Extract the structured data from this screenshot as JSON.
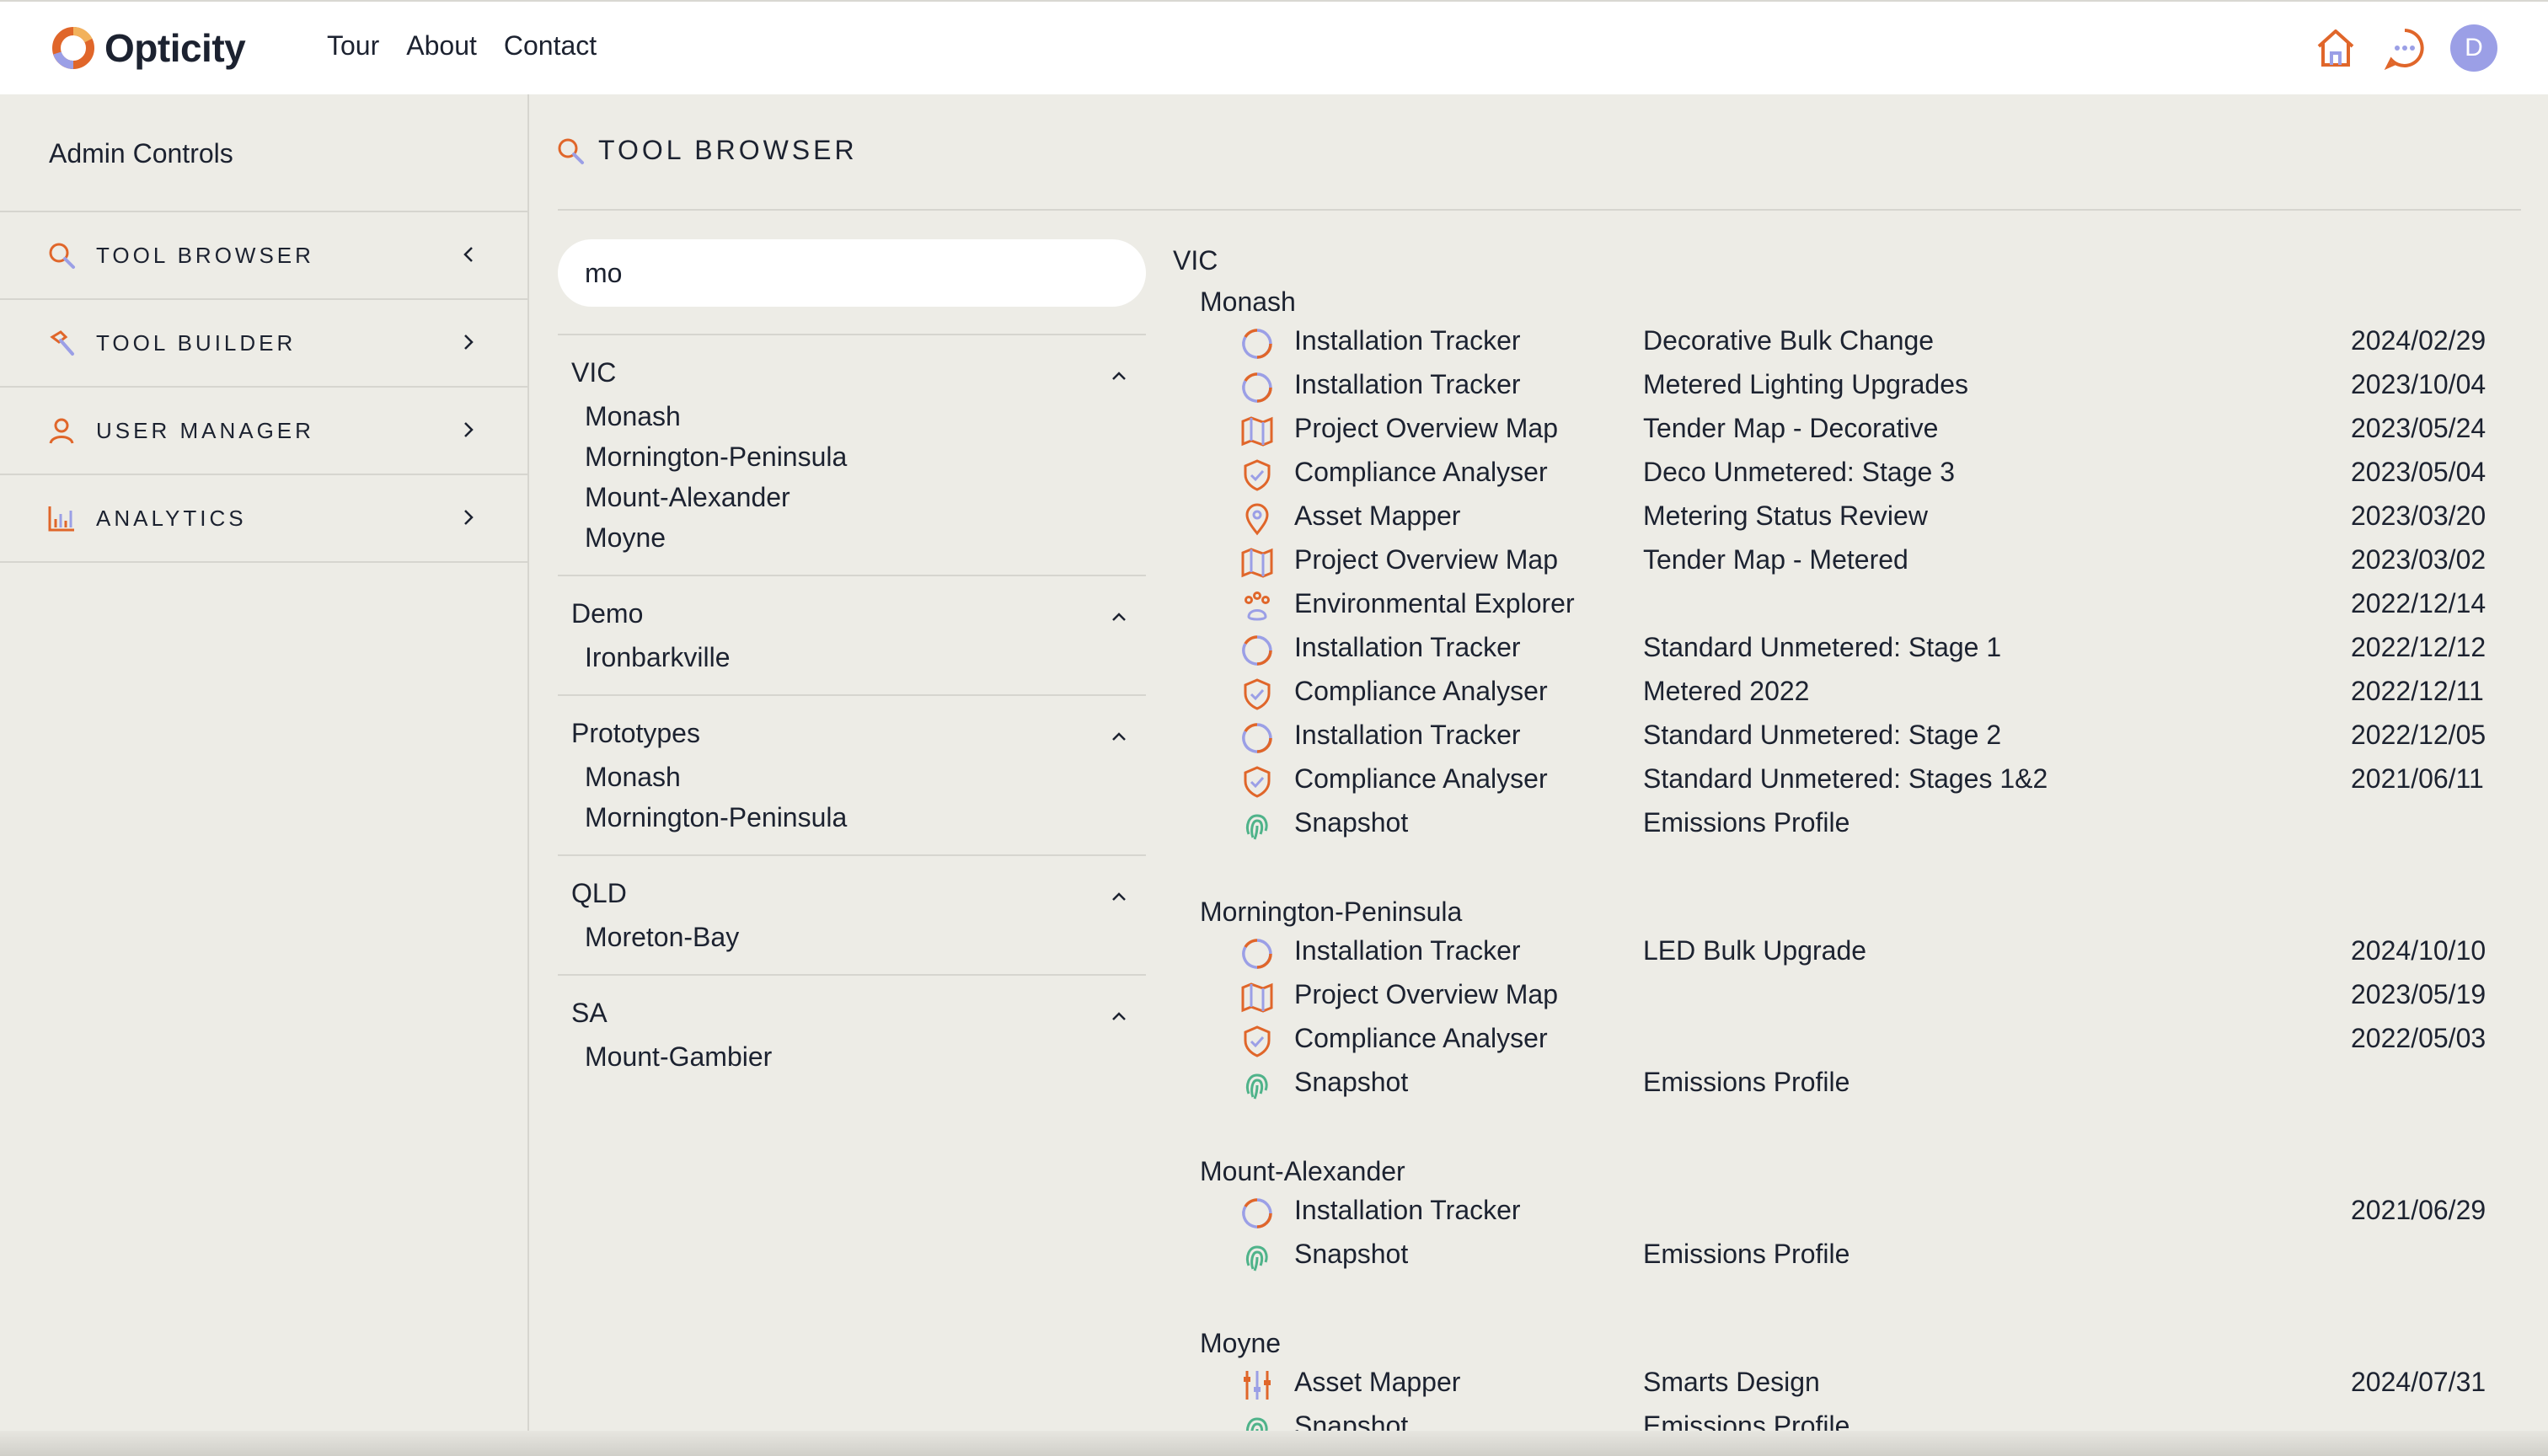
{
  "brand": {
    "name": "Opticity"
  },
  "nav": [
    {
      "label": "Tour"
    },
    {
      "label": "About"
    },
    {
      "label": "Contact"
    }
  ],
  "top_icons": [
    "home-icon",
    "chat-icon"
  ],
  "user": {
    "initial": "D"
  },
  "colors": {
    "accent_orange": "#e0662a",
    "accent_lavender": "#9b9fe6",
    "accent_green": "#4fb38a",
    "background": "#edece6"
  },
  "sidebar": {
    "title": "Admin Controls",
    "items": [
      {
        "label": "TOOL BROWSER",
        "icon": "search-icon",
        "chevron": "left"
      },
      {
        "label": "TOOL BUILDER",
        "icon": "hammer-icon",
        "chevron": "right"
      },
      {
        "label": "USER MANAGER",
        "icon": "user-icon",
        "chevron": "right"
      },
      {
        "label": "ANALYTICS",
        "icon": "bar-chart-icon",
        "chevron": "right"
      }
    ]
  },
  "main": {
    "title": "TOOL BROWSER"
  },
  "search": {
    "value": "mo"
  },
  "filters": [
    {
      "name": "VIC",
      "items": [
        "Monash",
        "Mornington-Peninsula",
        "Mount-Alexander",
        "Moyne"
      ]
    },
    {
      "name": "Demo",
      "items": [
        "Ironbarkville"
      ]
    },
    {
      "name": "Prototypes",
      "items": [
        "Monash",
        "Mornington-Peninsula"
      ]
    },
    {
      "name": "QLD",
      "items": [
        "Moreton-Bay"
      ]
    },
    {
      "name": "SA",
      "items": [
        "Mount-Gambier"
      ]
    }
  ],
  "results": {
    "state": "VIC",
    "groups": [
      {
        "name": "Monash",
        "rows": [
          {
            "icon": "progress-ring-icon",
            "tool": "Installation Tracker",
            "project": "Decorative Bulk Change",
            "date": "2024/02/29"
          },
          {
            "icon": "progress-ring-icon",
            "tool": "Installation Tracker",
            "project": "Metered Lighting Upgrades",
            "date": "2023/10/04"
          },
          {
            "icon": "map-icon",
            "tool": "Project Overview Map",
            "project": "Tender Map - Decorative",
            "date": "2023/05/24"
          },
          {
            "icon": "shield-check-icon",
            "tool": "Compliance Analyser",
            "project": "Deco Unmetered: Stage 3",
            "date": "2023/05/04"
          },
          {
            "icon": "map-pin-icon",
            "tool": "Asset Mapper",
            "project": "Metering Status Review",
            "date": "2023/03/20"
          },
          {
            "icon": "map-icon",
            "tool": "Project Overview Map",
            "project": "Tender Map - Metered",
            "date": "2023/03/02"
          },
          {
            "icon": "paw-icon",
            "tool": "Environmental Explorer",
            "project": "",
            "date": "2022/12/14"
          },
          {
            "icon": "progress-ring-icon",
            "tool": "Installation Tracker",
            "project": "Standard Unmetered: Stage 1",
            "date": "2022/12/12"
          },
          {
            "icon": "shield-check-icon",
            "tool": "Compliance Analyser",
            "project": "Metered 2022",
            "date": "2022/12/11"
          },
          {
            "icon": "progress-ring-icon",
            "tool": "Installation Tracker",
            "project": "Standard Unmetered: Stage 2",
            "date": "2022/12/05"
          },
          {
            "icon": "shield-check-icon",
            "tool": "Compliance Analyser",
            "project": "Standard Unmetered: Stages 1&2",
            "date": "2021/06/11"
          },
          {
            "icon": "fingerprint-icon",
            "tool": "Snapshot",
            "project": "Emissions Profile",
            "date": ""
          }
        ]
      },
      {
        "name": "Mornington-Peninsula",
        "rows": [
          {
            "icon": "progress-ring-icon",
            "tool": "Installation Tracker",
            "project": "LED Bulk Upgrade",
            "date": "2024/10/10"
          },
          {
            "icon": "map-icon",
            "tool": "Project Overview Map",
            "project": "",
            "date": "2023/05/19"
          },
          {
            "icon": "shield-check-icon",
            "tool": "Compliance Analyser",
            "project": "",
            "date": "2022/05/03"
          },
          {
            "icon": "fingerprint-icon",
            "tool": "Snapshot",
            "project": "Emissions Profile",
            "date": ""
          }
        ]
      },
      {
        "name": "Mount-Alexander",
        "rows": [
          {
            "icon": "progress-ring-icon",
            "tool": "Installation Tracker",
            "project": "",
            "date": "2021/06/29"
          },
          {
            "icon": "fingerprint-icon",
            "tool": "Snapshot",
            "project": "Emissions Profile",
            "date": ""
          }
        ]
      },
      {
        "name": "Moyne",
        "rows": [
          {
            "icon": "sliders-icon",
            "tool": "Asset Mapper",
            "project": "Smarts Design",
            "date": "2024/07/31"
          },
          {
            "icon": "fingerprint-icon",
            "tool": "Snapshot",
            "project": "Emissions Profile",
            "date": ""
          }
        ]
      }
    ]
  }
}
